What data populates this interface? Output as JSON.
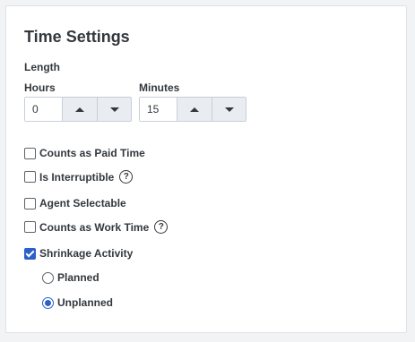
{
  "panel": {
    "title": "Time Settings",
    "length_label": "Length",
    "hours": {
      "label": "Hours",
      "value": "0"
    },
    "minutes": {
      "label": "Minutes",
      "value": "15"
    }
  },
  "options": {
    "paid_time": {
      "label": "Counts as Paid Time",
      "checked": false
    },
    "interruptible": {
      "label": "Is Interruptible",
      "checked": false,
      "help_icon": "question-circle-icon"
    },
    "agent_selectable": {
      "label": "Agent Selectable",
      "checked": false
    },
    "work_time": {
      "label": "Counts as Work Time",
      "checked": false,
      "help_icon": "question-circle-icon"
    },
    "shrinkage": {
      "label": "Shrinkage Activity",
      "checked": true
    }
  },
  "shrinkage_type": {
    "planned": {
      "label": "Planned",
      "selected": false
    },
    "unplanned": {
      "label": "Unplanned",
      "selected": true
    }
  },
  "colors": {
    "accent": "#2a60c8",
    "text": "#33383d",
    "stepper_bg": "#e9edf2"
  }
}
